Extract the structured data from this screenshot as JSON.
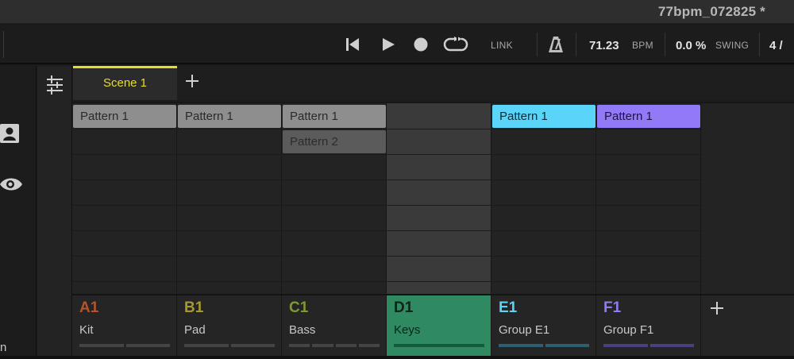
{
  "window": {
    "title": "77bpm_072825 *"
  },
  "transport": {
    "link_label": "LINK",
    "tempo_value": "71.23",
    "tempo_unit": "BPM",
    "swing_value": "0.0 %",
    "swing_label": "SWING",
    "signature": "4 /"
  },
  "left": {
    "partial_text": "n"
  },
  "scenes": [
    {
      "label": "Scene 1",
      "selected": true
    }
  ],
  "patterns": [
    {
      "label": "Pattern 1",
      "style": "gray"
    },
    {
      "label": "Pattern 1",
      "style": "gray"
    },
    {
      "label": "Pattern 1",
      "style": "gray"
    },
    {
      "label": "Pattern 2",
      "style": "dark"
    },
    {
      "label": "Pattern 1",
      "style": "cyan"
    },
    {
      "label": "Pattern 1",
      "style": "purple"
    }
  ],
  "groups": [
    {
      "id": "A1",
      "name": "Kit",
      "color": "#b5532c",
      "bar_color": "#444444",
      "bars": 2
    },
    {
      "id": "B1",
      "name": "Pad",
      "color": "#a69a2a",
      "bar_color": "#444444",
      "bars": 2
    },
    {
      "id": "C1",
      "name": "Bass",
      "color": "#7f9a2e",
      "bar_color": "#444444",
      "bars": 4
    },
    {
      "id": "D1",
      "name": "Keys",
      "color": "#0d2419",
      "bar_color": "#145a3b",
      "bars": 1,
      "selected": true
    },
    {
      "id": "E1",
      "name": "Group E1",
      "color": "#5ad4f8",
      "bar_color": "#2c6070",
      "bars": 2
    },
    {
      "id": "F1",
      "name": "Group F1",
      "color": "#9279f5",
      "bar_color": "#4b3f80",
      "bars": 2
    }
  ],
  "colors": {
    "scene_accent": "#e6dc2e",
    "selected_group": "#2f8a62"
  },
  "icons": [
    "skip-back-icon",
    "play-icon",
    "record-icon",
    "loop-icon",
    "metronome-icon",
    "mixer-icon",
    "user-icon",
    "eye-icon",
    "plus-icon"
  ]
}
